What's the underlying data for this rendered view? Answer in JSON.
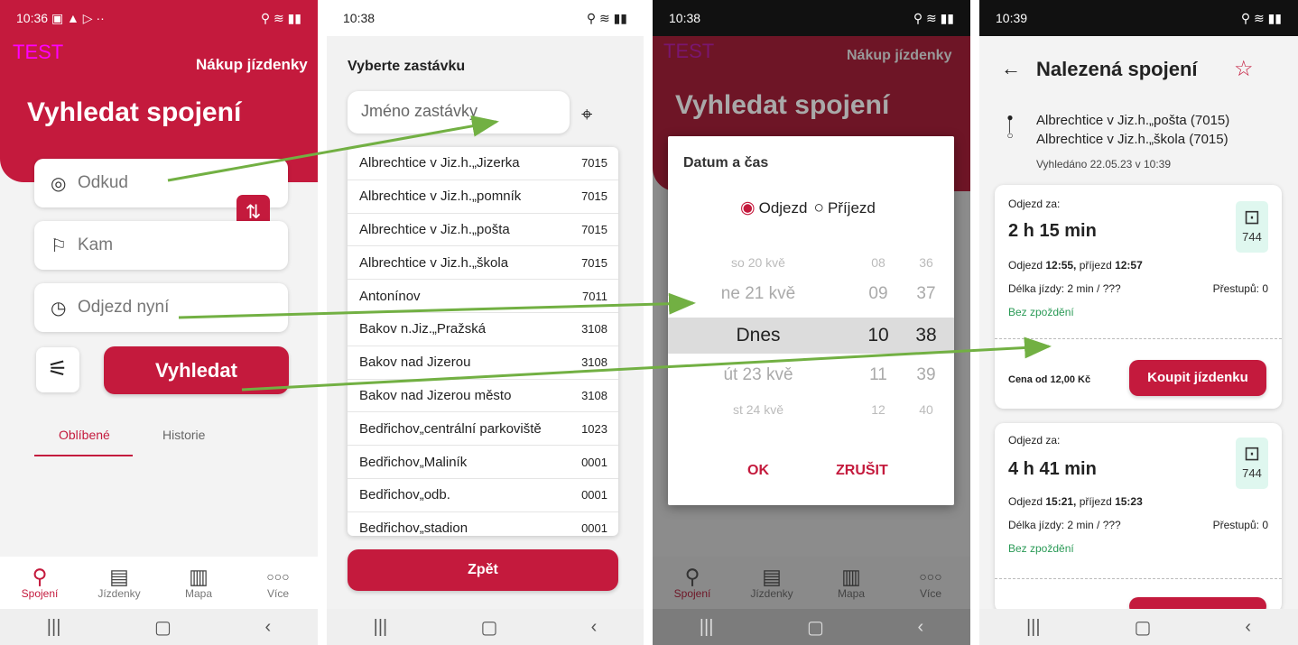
{
  "screen1": {
    "status_time": "10:36",
    "status_icons_left": "▣ ▲ ▷ ··",
    "status_icons_right": "⚲ ≋ ▮▮",
    "env_label": "TEST",
    "purchase_link": "Nákup jízdenky",
    "title": "Vyhledat spojení",
    "from_placeholder": "Odkud",
    "to_placeholder": "Kam",
    "departure_placeholder": "Odjezd nyní",
    "search_button": "Vyhledat",
    "tabs": [
      "Oblíbené",
      "Historie"
    ],
    "active_tab": "Oblíbené"
  },
  "bottom_nav": [
    {
      "label": "Spojení",
      "icon": "search-icon"
    },
    {
      "label": "Jízdenky",
      "icon": "ticket-icon"
    },
    {
      "label": "Mapa",
      "icon": "map-icon"
    },
    {
      "label": "Více",
      "icon": "more-icon"
    }
  ],
  "screen2": {
    "status_time": "10:38",
    "heading": "Vyberte zastávku",
    "search_placeholder": "Jméno zastávky",
    "stops": [
      {
        "name": "Albrechtice v Jiz.h.„Jizerka",
        "code": "7015"
      },
      {
        "name": "Albrechtice v Jiz.h.„pomník",
        "code": "7015"
      },
      {
        "name": "Albrechtice v Jiz.h.„pošta",
        "code": "7015"
      },
      {
        "name": "Albrechtice v Jiz.h.„škola",
        "code": "7015"
      },
      {
        "name": "Antonínov",
        "code": "7011"
      },
      {
        "name": "Bakov n.Jiz.„Pražská",
        "code": "3108"
      },
      {
        "name": "Bakov nad Jizerou",
        "code": "3108"
      },
      {
        "name": "Bakov nad Jizerou město",
        "code": "3108"
      },
      {
        "name": "Bedřichov„centrální parkoviště",
        "code": "1023"
      },
      {
        "name": "Bedřichov„Maliník",
        "code": "0001"
      },
      {
        "name": "Bedřichov„odb.",
        "code": "0001"
      },
      {
        "name": "Bedřichov„stadion",
        "code": "0001"
      }
    ],
    "back_button": "Zpět"
  },
  "screen3": {
    "status_time": "10:38",
    "dialog_title": "Datum a čas",
    "departure_option": "Odjezd",
    "arrival_option": "Příjezd",
    "selected_option": "Odjezd",
    "wheel_rows": [
      {
        "day": "so 20 kvě",
        "hour": "08",
        "minute": "36"
      },
      {
        "day": "ne 21 kvě",
        "hour": "09",
        "minute": "37"
      },
      {
        "day": "Dnes",
        "hour": "10",
        "minute": "38"
      },
      {
        "day": "út 23 kvě",
        "hour": "11",
        "minute": "39"
      },
      {
        "day": "st 24 kvě",
        "hour": "12",
        "minute": "40"
      }
    ],
    "ok": "OK",
    "cancel": "ZRUŠIT"
  },
  "screen4": {
    "status_time": "10:39",
    "title": "Nalezená spojení",
    "from_stop": "Albrechtice v Jiz.h.„pošta (7015)",
    "to_stop": "Albrechtice v Jiz.h.„škola (7015)",
    "searched": "Vyhledáno 22.05.23 v 10:39",
    "connections": [
      {
        "departure_in_label": "Odjezd za:",
        "departure_in": "2 h 15 min",
        "bus_line": "744",
        "times_prefix": "Odjezd ",
        "departure_time": "12:55,",
        "times_middle": " příjezd ",
        "arrival_time": "12:57",
        "duration": "Délka jízdy: 2 min / ???",
        "transfers": "Přestupů: 0",
        "delay_status": "Bez zpoždění",
        "price": "Cena od 12,00 Kč",
        "buy_button": "Koupit jízdenku"
      },
      {
        "departure_in_label": "Odjezd za:",
        "departure_in": "4 h 41 min",
        "bus_line": "744",
        "times_prefix": "Odjezd ",
        "departure_time": "15:21,",
        "times_middle": " příjezd ",
        "arrival_time": "15:23",
        "duration": "Délka jízdy: 2 min / ???",
        "transfers": "Přestupů: 0",
        "delay_status": "Bez zpoždění"
      }
    ]
  },
  "colors": {
    "brand_red": "#c41a3d",
    "annotation_green": "#72b043",
    "test_magenta": "#ff00ff"
  }
}
